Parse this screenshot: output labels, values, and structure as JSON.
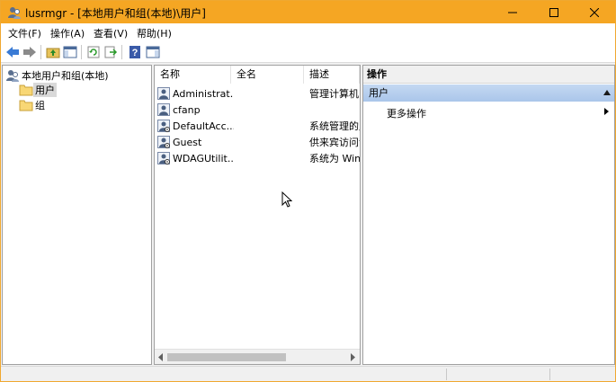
{
  "window": {
    "title": "lusrmgr - [本地用户和组(本地)\\用户]",
    "accent": "#f5a623"
  },
  "menu": [
    {
      "label": "文件(F)"
    },
    {
      "label": "操作(A)"
    },
    {
      "label": "查看(V)"
    },
    {
      "label": "帮助(H)"
    }
  ],
  "toolbar": {
    "icons": [
      "back-arrow-icon",
      "forward-arrow-icon",
      "up-folder-icon",
      "show-tree-icon",
      "refresh-icon",
      "export-list-icon",
      "help-icon",
      "properties-pane-icon"
    ]
  },
  "tree": {
    "root": "本地用户和组(本地)",
    "items": [
      {
        "label": "用户",
        "selected": true
      },
      {
        "label": "组",
        "selected": false
      }
    ]
  },
  "list": {
    "columns": [
      "名称",
      "全名",
      "描述"
    ],
    "rows": [
      {
        "name": "Administrat...",
        "fullname": "",
        "desc": "管理计算机("
      },
      {
        "name": "cfanp",
        "fullname": "",
        "desc": ""
      },
      {
        "name": "DefaultAcc...",
        "fullname": "",
        "desc": "系统管理的用"
      },
      {
        "name": "Guest",
        "fullname": "",
        "desc": "供来宾访问计"
      },
      {
        "name": "WDAGUtilit...",
        "fullname": "",
        "desc": "系统为 Wind"
      }
    ]
  },
  "actions": {
    "title": "操作",
    "section": "用户",
    "items": [
      {
        "label": "更多操作"
      }
    ]
  }
}
